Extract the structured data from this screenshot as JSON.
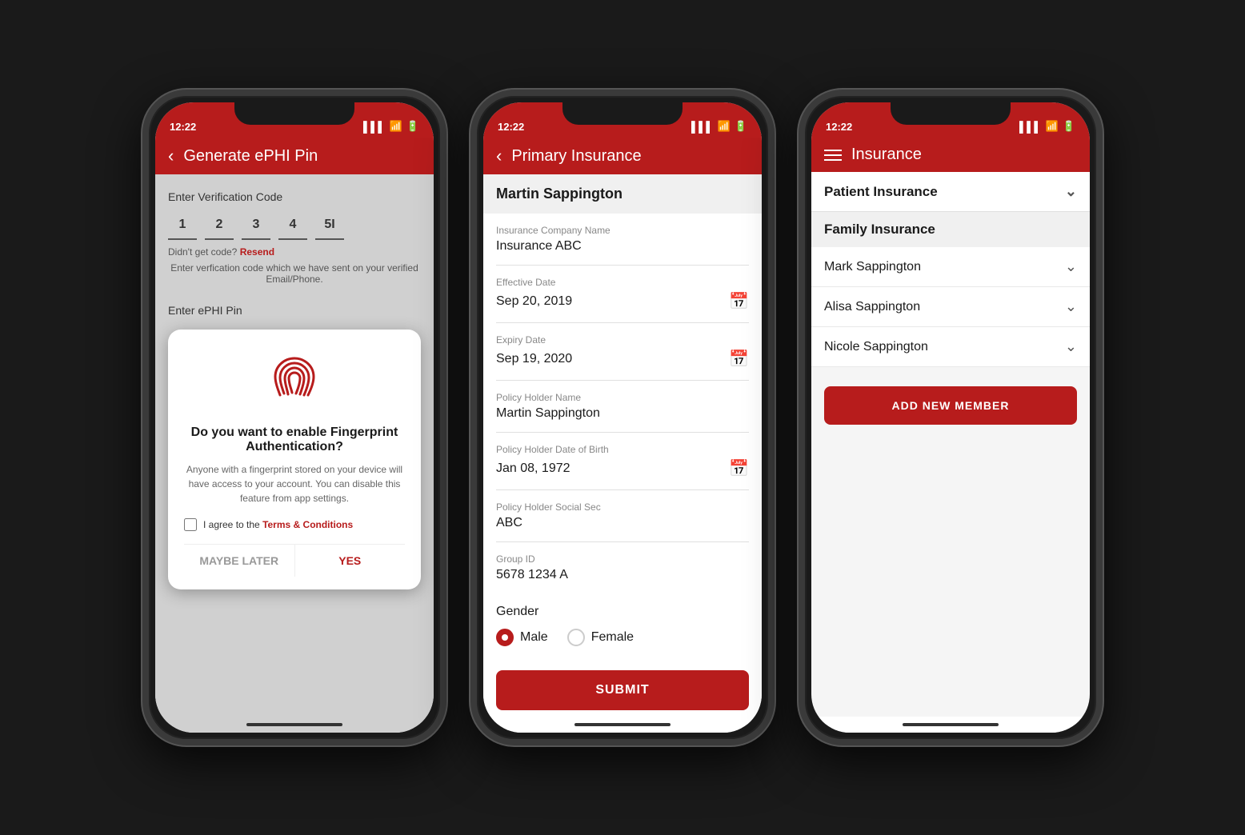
{
  "phone1": {
    "status_time": "12:22",
    "nav_title": "Generate ePHI Pin",
    "verify_label": "Enter Verification Code",
    "code_digits": [
      "1",
      "2",
      "3",
      "4",
      "5I"
    ],
    "resend_text": "Didn't get code?",
    "resend_label": "Resend",
    "verify_desc": "Enter verfication code which we have sent on your verified Email/Phone.",
    "ephi_label": "Enter ePHI Pin",
    "modal_title": "Do you want to enable Fingerprint Authentication?",
    "modal_desc": "Anyone with a fingerprint stored on your device will have access to your account. You can disable this feature from app settings.",
    "checkbox_label": "I agree to the",
    "tc_label": "Terms & Conditions",
    "maybe_label": "MAYBE LATER",
    "yes_label": "YES"
  },
  "phone2": {
    "status_time": "12:22",
    "nav_title": "Primary Insurance",
    "patient_name": "Martin Sappington",
    "fields": [
      {
        "label": "Insurance Company Name",
        "value": "Insurance ABC",
        "has_calendar": false
      },
      {
        "label": "Effective Date",
        "value": "Sep 20, 2019",
        "has_calendar": true
      },
      {
        "label": "Expiry Date",
        "value": "Sep 19, 2020",
        "has_calendar": true
      },
      {
        "label": "Policy Holder Name",
        "value": "Martin Sappington",
        "has_calendar": false
      },
      {
        "label": "Policy Holder Date of Birth",
        "value": "Jan 08, 1972",
        "has_calendar": true
      },
      {
        "label": "Policy Holder Social Sec",
        "value": "ABC",
        "has_calendar": false
      },
      {
        "label": "Group ID",
        "value": "5678 1234 A",
        "has_calendar": false
      }
    ],
    "gender_label": "Gender",
    "male_label": "Male",
    "female_label": "Female",
    "submit_label": "SUBMIT"
  },
  "phone3": {
    "status_time": "12:22",
    "nav_title": "Insurance",
    "patient_insurance_label": "Patient Insurance",
    "family_insurance_label": "Family Insurance",
    "members": [
      "Mark Sappington",
      "Alisa Sappington",
      "Nicole Sappington"
    ],
    "add_member_label": "ADD NEW MEMBER"
  }
}
